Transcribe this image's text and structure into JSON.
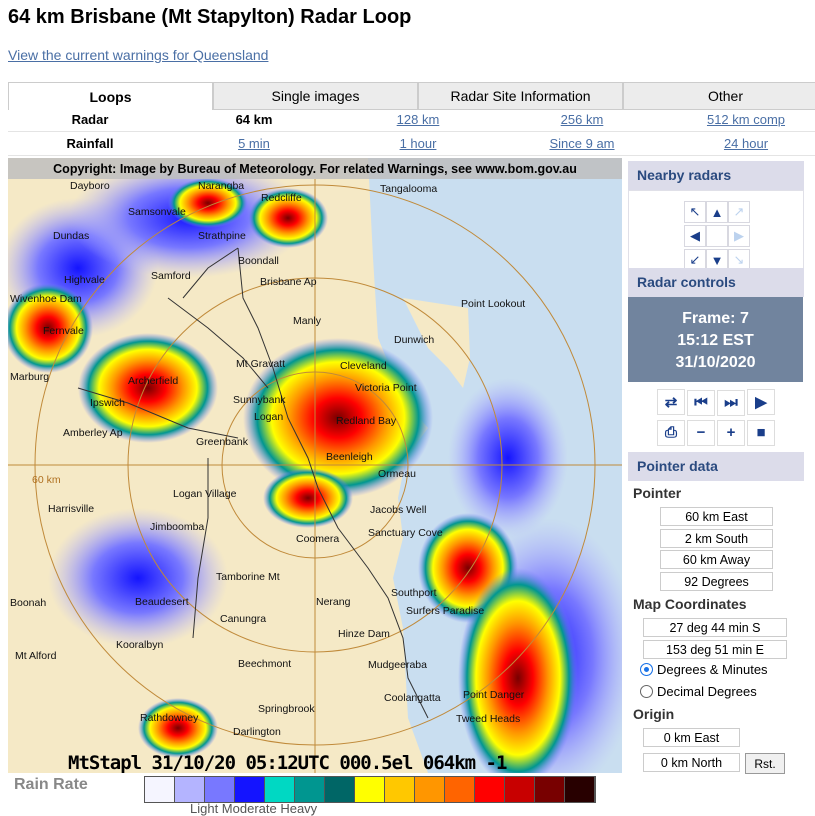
{
  "page": {
    "title": "64 km Brisbane (Mt Stapylton) Radar Loop",
    "warnings_link": "View the current warnings for Queensland"
  },
  "tabs": [
    "Loops",
    "Single images",
    "Radar Site Information",
    "Other"
  ],
  "radar_row": {
    "label": "Radar",
    "options": [
      "64 km",
      "128 km",
      "256 km",
      "512 km comp"
    ]
  },
  "rainfall_row": {
    "label": "Rainfall",
    "options": [
      "5 min",
      "1 hour",
      "Since 9 am",
      "24 hour"
    ]
  },
  "map": {
    "copyright": "Copyright: Image by Bureau of Meteorology. For related Warnings, see www.bom.gov.au",
    "stamp": "MtStapl 31/10/20 05:12UTC 000.5el 064km -1",
    "range_label": "60 km",
    "places": [
      "Dayboro",
      "Narangba",
      "Samsonvale",
      "Redcliffe",
      "Tangalooma",
      "Dundas",
      "Strathpine",
      "Boondall",
      "Highvale",
      "Samford",
      "Brisbane Ap",
      "Point Lookout",
      "Wivenhoe Dam",
      "Manly",
      "Fernvale",
      "Dunwich",
      "Mt Gravatt",
      "Cleveland",
      "Marburg",
      "Archerfield",
      "Victoria Point",
      "Sunnybank",
      "Ipswich",
      "Logan",
      "Redland Bay",
      "Amberley Ap",
      "Greenbank",
      "Beenleigh",
      "Logan Village",
      "Harrisville",
      "Jacobs Well",
      "Jimboomba",
      "Sanctuary Cove",
      "Coomera",
      "Tamborine Mt",
      "Southport",
      "Boonah",
      "Beaudesert",
      "Nerang",
      "Surfers Paradise",
      "Canungra",
      "Hinze Dam",
      "Kooralbyn",
      "Mt Alford",
      "Mudgeeraba",
      "Beechmont",
      "Coolangatta",
      "Point Danger",
      "Springbrook",
      "Tweed Heads",
      "Rathdowney",
      "Darlington",
      "Ormeau"
    ]
  },
  "legend": {
    "title": "Rain Rate",
    "words": "Light      Moderate      Heavy",
    "colors": [
      "#f5f5ff",
      "#b4b4ff",
      "#7878ff",
      "#1414ff",
      "#00d8c3",
      "#009690",
      "#006666",
      "#ffff00",
      "#ffc800",
      "#ff9600",
      "#ff6400",
      "#ff0000",
      "#c80000",
      "#780000",
      "#280000"
    ]
  },
  "nearby": {
    "title": "Nearby radars"
  },
  "controls": {
    "title": "Radar controls",
    "frame": "Frame: 7",
    "time": "15:12 EST",
    "date": "31/10/2020"
  },
  "pointer": {
    "title": "Pointer data",
    "pointer_label": "Pointer",
    "east": "60 km East",
    "south": "2 km South",
    "away": "60 km Away",
    "degrees": "92 Degrees",
    "map_coords_label": "Map Coordinates",
    "lat": "27 deg 44 min S",
    "lon": "153 deg 51 min E",
    "opt_dm": "Degrees & Minutes",
    "opt_dd": "Decimal Degrees",
    "origin_label": "Origin",
    "origin_east": "0 km East",
    "origin_north": "0 km North",
    "reset": "Rst."
  }
}
